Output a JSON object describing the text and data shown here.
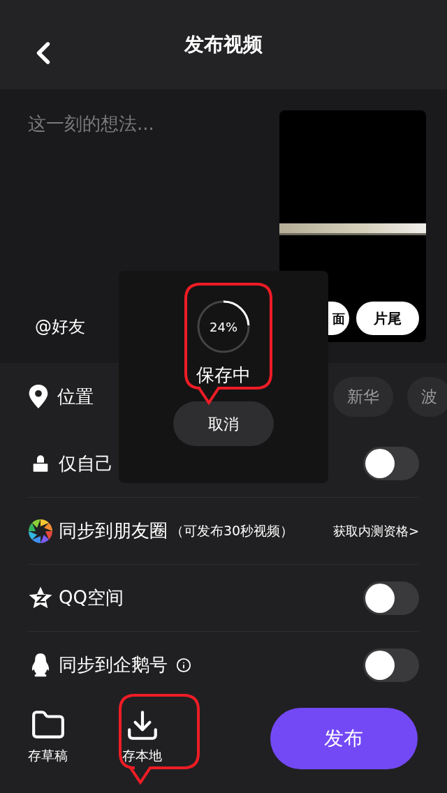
{
  "header": {
    "title": "发布视频"
  },
  "caption": {
    "placeholder": "这一刻的想法..."
  },
  "mention": "@好友",
  "cover_buttons": [
    {
      "label": "面"
    },
    {
      "label": "片尾"
    }
  ],
  "location": {
    "label": "位置",
    "chips": [
      "新华",
      "波"
    ]
  },
  "options": [
    {
      "kind": "toggle",
      "label": "仅自己",
      "on": false
    },
    {
      "kind": "link",
      "label": "同步到朋友圈",
      "note": "（可发布30秒视频）",
      "action": "获取内测资格>"
    },
    {
      "kind": "toggle",
      "label": "QQ空间",
      "on": false
    },
    {
      "kind": "toggle",
      "label": "同步到企鹅号",
      "on": false,
      "info": true
    }
  ],
  "saving": {
    "percent": "24%",
    "status": "保存中",
    "cancel": "取消"
  },
  "bottom": {
    "actions": [
      "存草稿",
      "存本地"
    ],
    "publish": "发布"
  }
}
